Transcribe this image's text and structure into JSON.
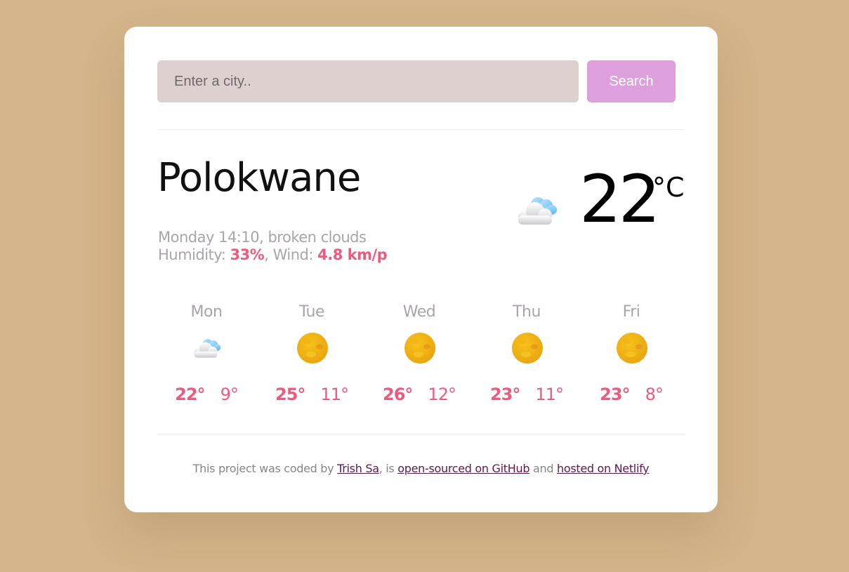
{
  "search": {
    "placeholder": "Enter a city..",
    "button_label": "Search"
  },
  "current": {
    "city": "Polokwane",
    "day_time": "Monday 14:10",
    "description": "broken clouds",
    "humidity_label": "Humidity:",
    "humidity": "33%",
    "wind_label": "Wind:",
    "wind": "4.8 km/p",
    "temperature": "22",
    "unit": "°C",
    "icon": "broken-clouds-icon"
  },
  "forecast": [
    {
      "day": "Mon",
      "max": "22°",
      "min": "9°",
      "icon": "broken-clouds-icon"
    },
    {
      "day": "Tue",
      "max": "25°",
      "min": "11°",
      "icon": "sun-icon"
    },
    {
      "day": "Wed",
      "max": "26°",
      "min": "12°",
      "icon": "sun-icon"
    },
    {
      "day": "Thu",
      "max": "23°",
      "min": "11°",
      "icon": "sun-icon"
    },
    {
      "day": "Fri",
      "max": "23°",
      "min": "8°",
      "icon": "sun-icon"
    }
  ],
  "footer": {
    "prefix": "This project was coded by ",
    "author_link": "Trish Sa",
    "middle1": ", is ",
    "github_link": "open-sourced on GitHub",
    "middle2": " and ",
    "netlify_link": "hosted on Netlify"
  },
  "colors": {
    "background": "#d4b48a",
    "card": "#ffffff",
    "input_bg": "#dfd0d0",
    "button_bg": "#dda0dd",
    "accent": "#ee5a7c",
    "muted": "#a9a4aa",
    "link": "#5d1a4a"
  }
}
